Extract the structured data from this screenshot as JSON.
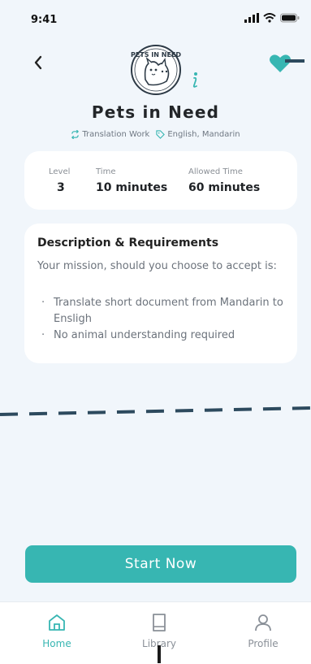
{
  "status_bar": {
    "time": "9:41"
  },
  "header": {
    "back_icon": "chevron-left-icon",
    "favorite_icon": "heart-icon",
    "info_icon": "info-icon",
    "logo_alt": "PETS IN NEED",
    "org_name": "Pets in Need",
    "tags": [
      {
        "icon": "repeat-icon",
        "label": "Translation Work"
      },
      {
        "icon": "tag-icon",
        "label": "English, Mandarin"
      }
    ]
  },
  "stats": [
    {
      "label": "Level",
      "value": "3"
    },
    {
      "label": "Time",
      "value": "10 minutes"
    },
    {
      "label": "Allowed Time",
      "value": "60 minutes"
    }
  ],
  "description": {
    "title": "Description & Requirements",
    "intro": "Your mission, should you choose to accept is:",
    "items": [
      "Translate short document from Mandarin to Ensligh",
      "No animal understanding required"
    ]
  },
  "cta": {
    "label": "Start Now"
  },
  "tabs": [
    {
      "icon": "home-icon",
      "label": "Home",
      "active": true
    },
    {
      "icon": "book-icon",
      "label": "Library",
      "active": false
    },
    {
      "icon": "user-icon",
      "label": "Profile",
      "active": false
    }
  ],
  "colors": {
    "accent": "#37b6b2",
    "background": "#f1f6fb",
    "dark_accent": "#2d4a5e"
  }
}
